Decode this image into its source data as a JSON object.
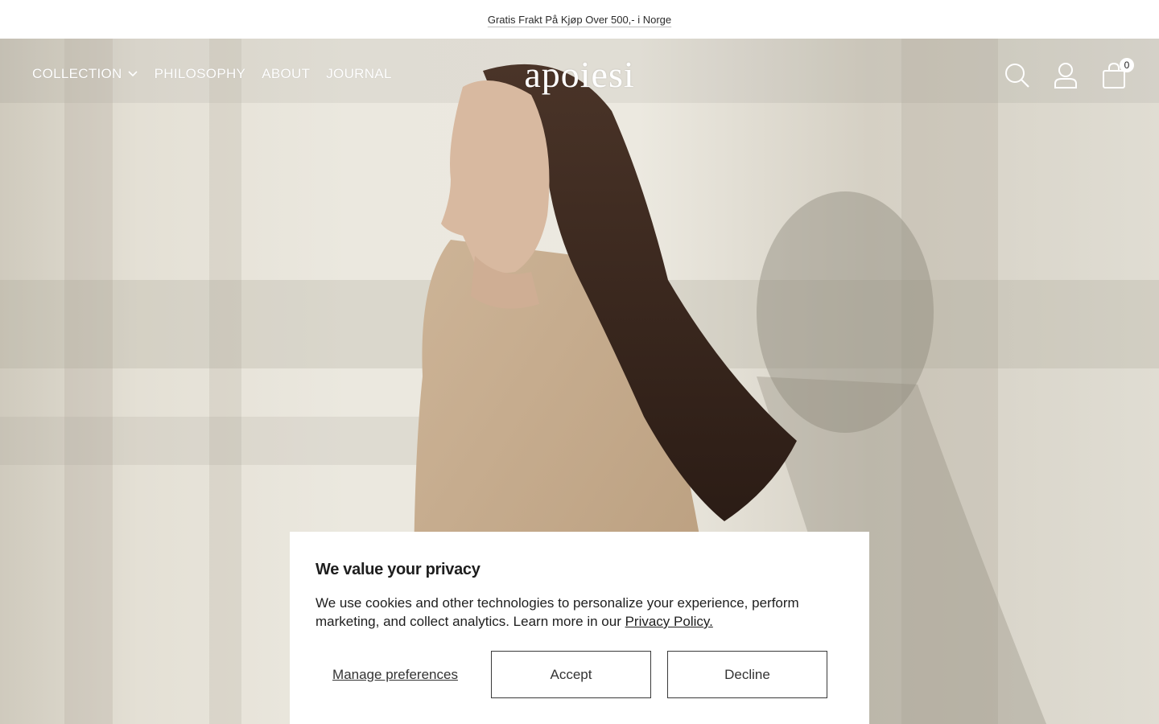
{
  "announcement": {
    "text": "Gratis Frakt På Kjøp Over 500,- i Norge"
  },
  "header": {
    "logo": "apoiesi",
    "nav": [
      {
        "label": "COLLECTION",
        "has_dropdown": true
      },
      {
        "label": "PHILOSOPHY"
      },
      {
        "label": "ABOUT"
      },
      {
        "label": "JOURNAL"
      }
    ],
    "icons": [
      "search-icon",
      "account-icon",
      "cart-icon"
    ],
    "cart_count": "0"
  },
  "cookie_banner": {
    "title": "We value your privacy",
    "text": "We use cookies and other technologies to personalize your experience, perform marketing, and collect analytics. Learn more in our ",
    "link_text": "Privacy Policy.",
    "manage_label": "Manage preferences",
    "accept_label": "Accept",
    "decline_label": "Decline"
  },
  "colors": {
    "nav_text": "#ffffff",
    "banner_bg": "#ffffff",
    "button_border": "#3a3a3a"
  }
}
